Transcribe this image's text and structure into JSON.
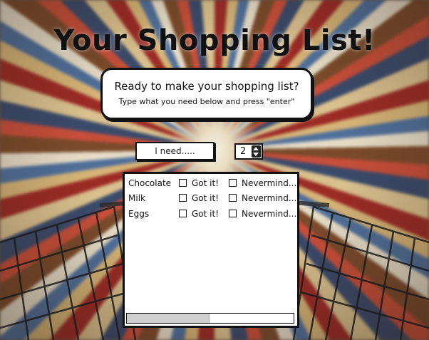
{
  "title": "Your Shopping List!",
  "intro": {
    "heading": "Ready to make your shopping list?",
    "instruction": "Type what you need below and press \"enter\""
  },
  "new_item": {
    "placeholder": "I need.....",
    "value": ""
  },
  "quantity": {
    "value": "2"
  },
  "items": [
    {
      "name": "Chocolate",
      "got_label": "Got it!",
      "nevermind_label": "Nevermind....",
      "got": false,
      "nevermind": false
    },
    {
      "name": "Milk",
      "got_label": "Got it!",
      "nevermind_label": "Nevermind....",
      "got": false,
      "nevermind": false
    },
    {
      "name": "Eggs",
      "got_label": "Got it!",
      "nevermind_label": "Nevermind....",
      "got": false,
      "nevermind": false
    }
  ],
  "scrollbar": {
    "position": 0,
    "visible_fraction": 0.5
  },
  "icons": {
    "stepper_up": "triangle-up-icon",
    "stepper_down": "triangle-down-icon",
    "checkbox": "checkbox-icon"
  }
}
